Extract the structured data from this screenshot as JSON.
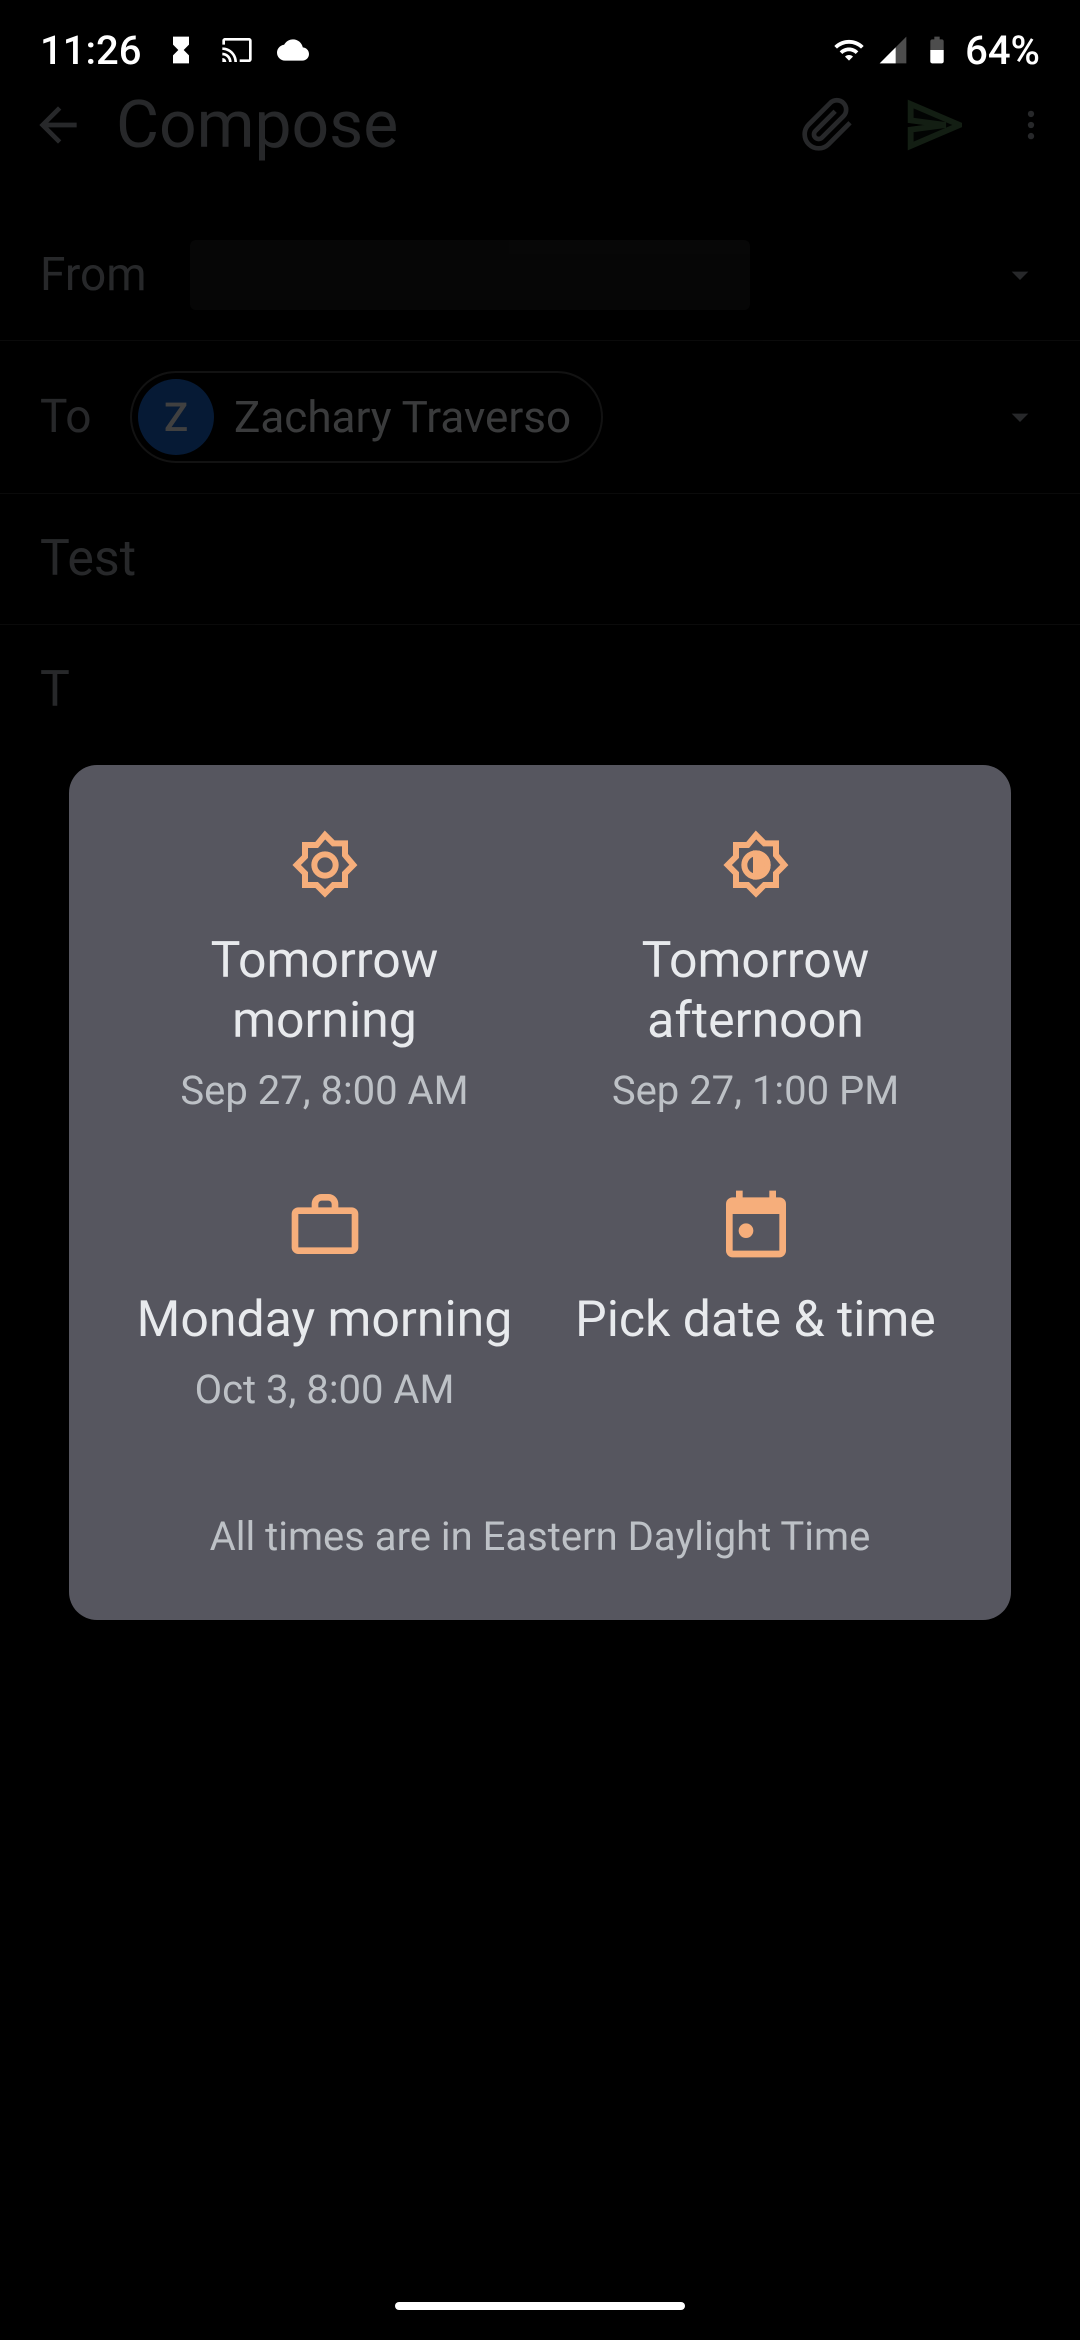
{
  "status": {
    "time": "11:26",
    "battery": "64%"
  },
  "compose": {
    "title": "Compose",
    "from_label": "From",
    "to_label": "To",
    "recipient": {
      "initial": "Z",
      "name": "Zachary Traverso"
    },
    "subject": "Test",
    "body_preview": "T"
  },
  "dialog": {
    "options": [
      {
        "title": "Tomorrow morning",
        "subtitle": "Sep 27, 8:00 AM"
      },
      {
        "title": "Tomorrow afternoon",
        "subtitle": "Sep 27, 1:00 PM"
      },
      {
        "title": "Monday morning",
        "subtitle": "Oct 3, 8:00 AM"
      },
      {
        "title": "Pick date & time",
        "subtitle": ""
      }
    ],
    "footer": "All times are in Eastern Daylight Time"
  }
}
